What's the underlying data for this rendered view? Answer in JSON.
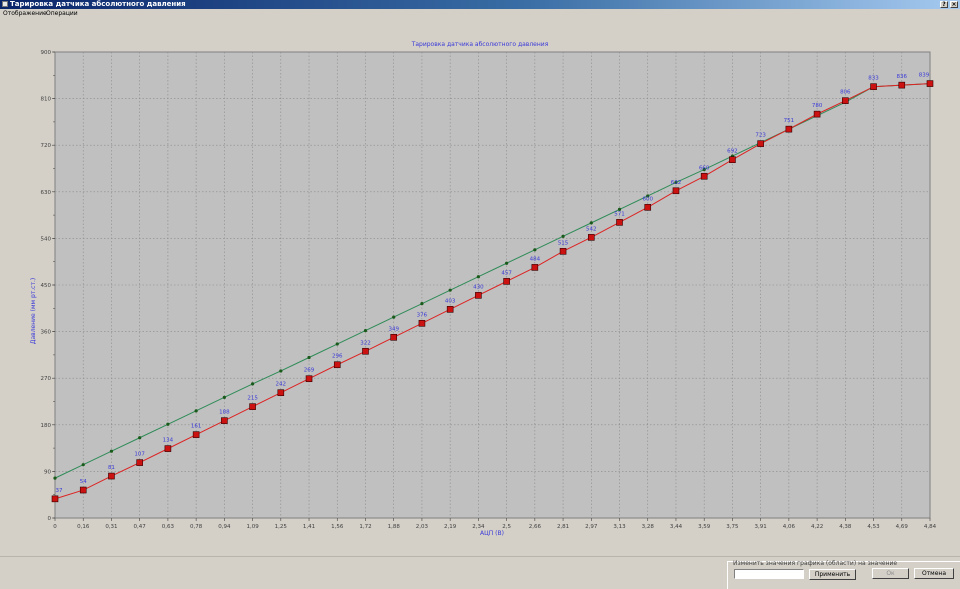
{
  "window": {
    "title": "Тарировка датчика абсолютного давления"
  },
  "menu": {
    "items": [
      "Отображение",
      "Операции"
    ]
  },
  "window_controls": {
    "help": "?",
    "close": "×"
  },
  "chart_data": {
    "type": "line",
    "title": "Тарировка датчика абсолютного давления",
    "xlabel": "АЦП (В)",
    "ylabel": "Давление (мм рт.ст.)",
    "x_ticks": [
      "0",
      "0,16",
      "0,31",
      "0,47",
      "0,63",
      "0,78",
      "0,94",
      "1,09",
      "1,25",
      "1,41",
      "1,56",
      "1,72",
      "1,88",
      "2,03",
      "2,19",
      "2,34",
      "2,5",
      "2,66",
      "2,81",
      "2,97",
      "3,13",
      "3,28",
      "3,44",
      "3,59",
      "3,75",
      "3,91",
      "4,06",
      "4,22",
      "4,38",
      "4,53",
      "4,69",
      "4,84"
    ],
    "y_ticks": [
      0,
      90,
      180,
      270,
      360,
      450,
      540,
      630,
      720,
      810,
      900
    ],
    "ylim": [
      0,
      900
    ],
    "grid": true,
    "series": [
      {
        "color": "#2e8b57",
        "values": [
          77,
          103,
          129,
          155,
          181,
          207,
          233,
          259,
          284,
          310,
          336,
          362,
          388,
          414,
          440,
          466,
          492,
          518,
          544,
          570,
          596,
          622,
          648,
          673,
          699,
          725,
          751,
          777,
          803,
          833,
          836,
          839
        ]
      },
      {
        "color": "#dd2222",
        "values": [
          37,
          54,
          81,
          107,
          134,
          161,
          188,
          215,
          242,
          269,
          296,
          322,
          349,
          376,
          403,
          430,
          457,
          484,
          515,
          542,
          571,
          600,
          632,
          660,
          692,
          723,
          751,
          780,
          806,
          833,
          836,
          839
        ],
        "labels": [
          "37",
          "54",
          "81",
          "107",
          "134",
          "161",
          "188",
          "215",
          "242",
          "269",
          "296",
          "322",
          "349",
          "376",
          "403",
          "430",
          "457",
          "484",
          "515",
          "542",
          "571",
          "600",
          "632",
          "660",
          "692",
          "723",
          "751",
          "780",
          "806",
          "833",
          "836",
          "839"
        ]
      }
    ],
    "colors": {
      "background": "#c0c0c0",
      "grid": "#8a8a8a",
      "label": "#3a3ad8",
      "axis_text": "#404040"
    }
  },
  "bottom_panel": {
    "edit_label": "Изменить значения графика (области) на значение",
    "input_value": "",
    "apply_button": "Применить",
    "ok_button": "Ок",
    "cancel_button": "Отмена"
  }
}
